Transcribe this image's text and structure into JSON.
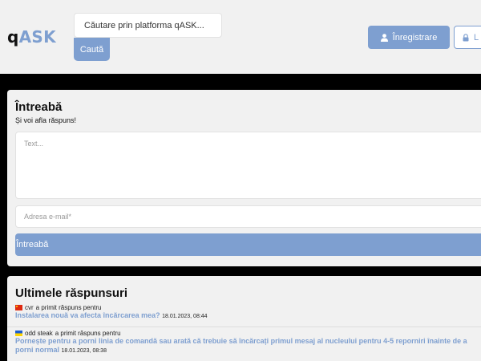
{
  "header": {
    "logo_q": "q",
    "logo_ask": "ASK",
    "search_placeholder": "Căutare prin platforma qASK...",
    "search_button": "Caută",
    "register_label": "Înregistrare",
    "login_label": "L",
    "user_icon": "user-icon",
    "lock_icon": "lock-icon"
  },
  "ask": {
    "title": "Întreabă",
    "subtitle": "Și voi afla răspuns!",
    "text_placeholder": "Text...",
    "email_placeholder": "Adresa e-mail*",
    "submit_label": "Întreabă"
  },
  "answers": {
    "title": "Ultimele răspunsuri",
    "items": [
      {
        "flag": "cn-flag-icon",
        "user": "cvr",
        "action": "a primit răspuns pentru",
        "question": "Instalarea nouă va afecta încărcarea mea?",
        "date": "18.01.2023, 08:44"
      },
      {
        "flag": "ua-flag-icon",
        "user": "odd steak",
        "action": "a primit răspuns pentru",
        "question": "Pornește pentru a porni linia de comandă sau arată că trebuie să încărcați primul mesaj al nucleului pentru 4-5 reporniri înainte de a porni normal",
        "date": "18.01.2023, 08:38"
      }
    ]
  },
  "colors": {
    "accent": "#7e9fd0",
    "card_bg": "#f1f1f1",
    "page_bg": "#000000"
  }
}
